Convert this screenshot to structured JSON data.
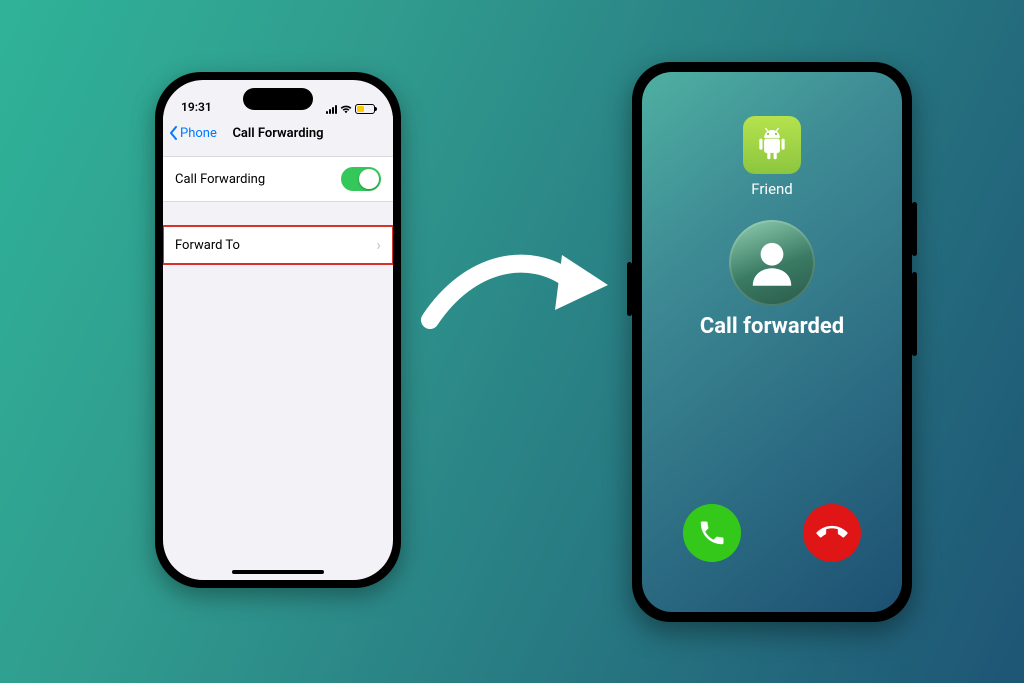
{
  "iphone": {
    "status_time": "19:31",
    "back_label": "Phone",
    "page_title": "Call Forwarding",
    "row_forwarding_label": "Call Forwarding",
    "row_forwardto_label": "Forward To",
    "toggle_on": true
  },
  "android": {
    "contact_name": "Friend",
    "status_text": "Call forwarded"
  },
  "colors": {
    "ios_accent": "#007aff",
    "toggle_on": "#34c759",
    "highlight_border": "#d9322b",
    "accept": "#34c91a",
    "decline": "#e01515"
  }
}
